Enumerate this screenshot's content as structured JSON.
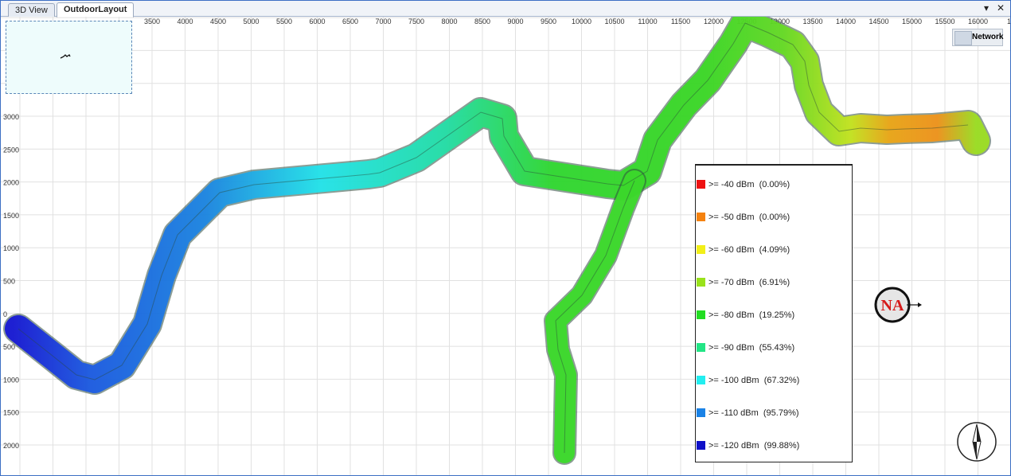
{
  "tabs": [
    {
      "label": "3D View",
      "active": false
    },
    {
      "label": "OutdoorLayout",
      "active": true
    }
  ],
  "tab_controls": {
    "dropdown": "▾",
    "close": "✕"
  },
  "x_ticks": [
    "3500",
    "4000",
    "4500",
    "5000",
    "5500",
    "6000",
    "6500",
    "7000",
    "7500",
    "8000",
    "8500",
    "9000",
    "9500",
    "10000",
    "10500",
    "11000",
    "11500",
    "12000",
    "12500",
    "13000",
    "13500",
    "14000",
    "14500",
    "15000",
    "15500",
    "16000",
    "16"
  ],
  "y_ticks": [
    "3000",
    "2500",
    "2000",
    "1500",
    "1000",
    "500",
    "0",
    "500",
    "1000",
    "1500",
    "2000"
  ],
  "network_button": {
    "label": "Network"
  },
  "legend": [
    {
      "label": ">= -40 dBm",
      "percent": "(0.00%)",
      "color": "#ee1111"
    },
    {
      "label": ">= -50 dBm",
      "percent": "(0.00%)",
      "color": "#f5820f"
    },
    {
      "label": ">= -60 dBm",
      "percent": "(4.09%)",
      "color": "#f2ef18"
    },
    {
      "label": ">= -70 dBm",
      "percent": "(6.91%)",
      "color": "#99e21b"
    },
    {
      "label": ">= -80 dBm",
      "percent": "(19.25%)",
      "color": "#22dd22"
    },
    {
      "label": ">= -90 dBm",
      "percent": "(55.43%)",
      "color": "#22e585"
    },
    {
      "label": ">= -100 dBm",
      "percent": "(67.32%)",
      "color": "#22eef0"
    },
    {
      "label": ">= -110 dBm",
      "percent": "(95.79%)",
      "color": "#1a82e6"
    },
    {
      "label": ">= -120 dBm",
      "percent": "(99.88%)",
      "color": "#0f10c8"
    }
  ],
  "na_marker": "NA",
  "compass_icon": "north-arrow-icon",
  "colors": {
    "grid": "#e1e1e1",
    "tab_border": "#9aa8bd",
    "frame": "#3c6fc4"
  }
}
